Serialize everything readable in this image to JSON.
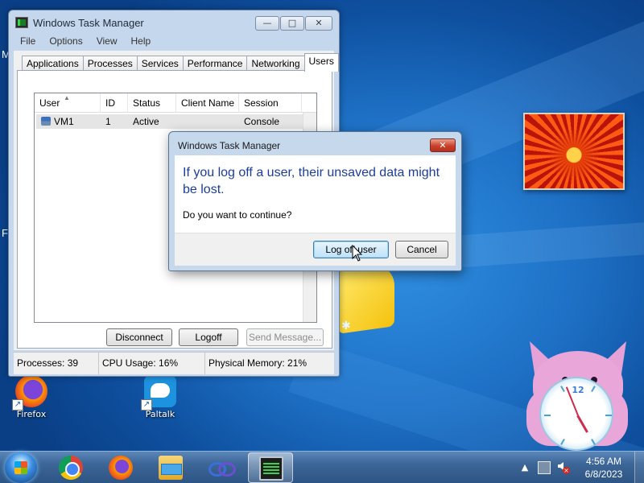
{
  "desktop": {
    "edge_letters": [
      "M",
      "F"
    ],
    "icons": [
      {
        "label": "Firefox",
        "icon": "firefox-icon"
      },
      {
        "label": "Paltalk",
        "icon": "paltalk-icon"
      }
    ]
  },
  "clock_gadget": {
    "number": "12"
  },
  "task_manager": {
    "title": "Windows Task Manager",
    "window_controls": {
      "minimize": "—",
      "maximize": "□",
      "close": "✕"
    },
    "menu": [
      "File",
      "Options",
      "View",
      "Help"
    ],
    "tabs": [
      "Applications",
      "Processes",
      "Services",
      "Performance",
      "Networking",
      "Users"
    ],
    "active_tab": "Users",
    "columns": [
      "User",
      "ID",
      "Status",
      "Client Name",
      "Session"
    ],
    "rows": [
      {
        "user": "VM1",
        "id": "1",
        "status": "Active",
        "client_name": "",
        "session": "Console"
      }
    ],
    "buttons": {
      "disconnect": "Disconnect",
      "logoff": "Logoff",
      "send_message": "Send Message..."
    },
    "status": {
      "processes": "Processes: 39",
      "cpu": "CPU Usage: 16%",
      "memory": "Physical Memory: 21%"
    }
  },
  "dialog": {
    "title": "Windows Task Manager",
    "close_glyph": "✕",
    "main_instruction": "If you log off a user, their unsaved data might be lost.",
    "question": "Do you want to continue?",
    "buttons": {
      "log_off_user": "Log off user",
      "cancel": "Cancel"
    }
  },
  "taskbar": {
    "apps": [
      "chrome-icon",
      "firefox-icon",
      "file-explorer-icon",
      "link-app-icon",
      "task-manager-icon"
    ],
    "active_app": "task-manager-icon",
    "tray": {
      "chevron": "▲"
    },
    "time": "4:56 AM",
    "date": "6/8/2023"
  },
  "colors": {
    "dialog_instruction": "#1b3e9a",
    "desktop_blue": "#1d6fc4",
    "dialog_close_red": "#c9402a"
  }
}
